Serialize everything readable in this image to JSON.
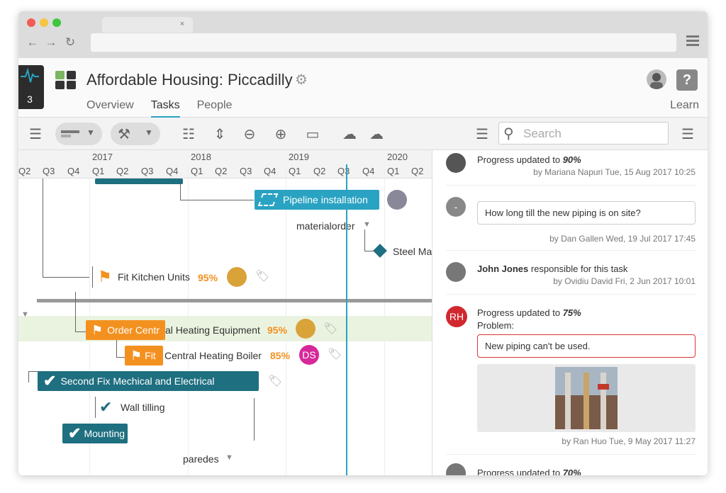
{
  "browser": {
    "tab_close": "×",
    "back": "←",
    "forward": "→",
    "reload": "↻"
  },
  "app": {
    "badge_count": "3",
    "project_title": "Affordable Housing: Piccadilly",
    "tabs": [
      {
        "label": "Overview"
      },
      {
        "label": "Tasks"
      },
      {
        "label": "People"
      }
    ],
    "learn": "Learn",
    "help": "?"
  },
  "toolbar": {
    "search_placeholder": "Search"
  },
  "gantt": {
    "years": [
      "2017",
      "2018",
      "2019",
      "2020"
    ],
    "quarters": [
      "Q2",
      "Q3",
      "Q4",
      "Q1",
      "Q2",
      "Q3",
      "Q4",
      "Q1",
      "Q2",
      "Q3",
      "Q4",
      "Q1",
      "Q2",
      "Q3",
      "Q4",
      "Q1",
      "Q2"
    ],
    "tasks": {
      "pipeline": "Pipeline installation",
      "materialorder": "materialorder",
      "steel": "Steel Ma",
      "kitchen": "Fit Kitchen Units",
      "kitchen_pct": "95%",
      "order_heating_a": "Order Centr",
      "order_heating_b": "al Heating Equipment",
      "order_pct": "95%",
      "boiler_a": "Fit",
      "boiler_b": "Central Heating Boiler",
      "boiler_pct": "85%",
      "boiler_initials": "DS",
      "second_fix": "Second Fix Mechical and Electrical",
      "wall": "Wall tilling",
      "mounting": "Mounting",
      "paredes": "paredes"
    },
    "colors": {
      "teal": "#2aa3c2",
      "dark_teal": "#1e6f80",
      "orange": "#f39120",
      "today": "#2aa3c2"
    }
  },
  "feed": {
    "items": [
      {
        "text_pre": "Progress updated to ",
        "text_val": "90%",
        "meta": "by Mariana Napuri Tue, 15 Aug 2017 10:25"
      },
      {
        "initial": "-",
        "bubble": "How long till the new piping is on site?",
        "meta": "by Dan Gallen Wed, 19 Jul 2017 17:45"
      },
      {
        "name": "John Jones",
        "text": " responsible for this task",
        "meta": "by Ovidiu David Fri, 2 Jun 2017 10:01"
      },
      {
        "initials": "RH",
        "text_pre": "Progress updated to ",
        "text_val": "75%",
        "problem": "Problem:",
        "bubble": "New piping can't be used.",
        "meta": "by Ran Huo Tue, 9 May 2017 11:27"
      },
      {
        "text_pre": "Progress updated to ",
        "text_val": "70%"
      }
    ]
  }
}
